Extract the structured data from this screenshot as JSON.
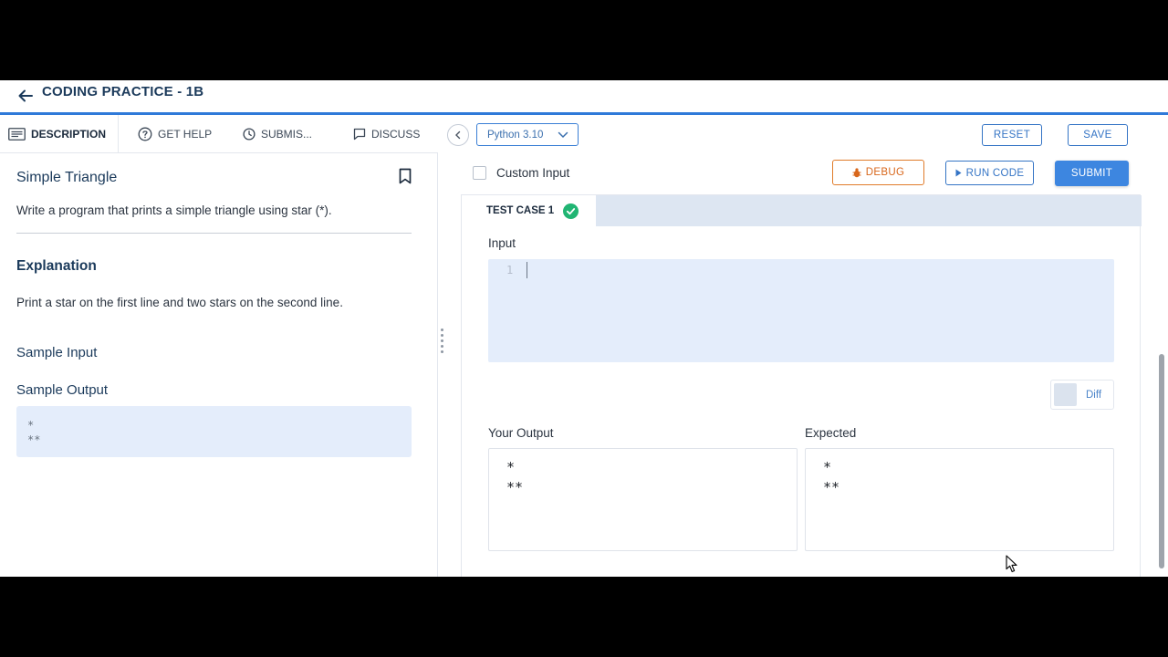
{
  "header": {
    "title": "CODING PRACTICE - 1B",
    "back_icon": "arrow-left-icon"
  },
  "left_tabs": [
    {
      "label": "DESCRIPTION",
      "icon": "description-icon",
      "active": true
    },
    {
      "label": "GET HELP",
      "icon": "help-circle-icon",
      "active": false
    },
    {
      "label": "SUBMIS...",
      "icon": "clock-icon",
      "active": false
    },
    {
      "label": "DISCUSS",
      "icon": "chat-icon",
      "active": false
    }
  ],
  "problem": {
    "title": "Simple Triangle",
    "statement": "Write a program that prints a simple triangle using star (*).",
    "explanation_title": "Explanation",
    "explanation": "Print a star on the first line and two stars on the second line.",
    "sample_input_label": "Sample Input",
    "sample_output_label": "Sample Output",
    "sample_output": "*\n**"
  },
  "editor_toolbar": {
    "language": "Python 3.10",
    "reset_label": "RESET",
    "save_label": "SAVE"
  },
  "run_bar": {
    "custom_input_label": "Custom Input",
    "custom_input_checked": false,
    "debug_label": "DEBUG",
    "run_label": "RUN CODE",
    "submit_label": "SUBMIT"
  },
  "test_case": {
    "tab_label": "TEST CASE 1",
    "passed": true,
    "input_label": "Input",
    "input_line_number": "1",
    "input_value": "",
    "diff_label": "Diff",
    "your_output_label": "Your Output",
    "your_output": "*\n**",
    "expected_label": "Expected",
    "expected_output": "*\n**"
  },
  "colors": {
    "accent": "#2f7ad9",
    "title": "#1b3a5b",
    "debug": "#e07b2a",
    "success": "#21b573",
    "submit": "#3d86e0"
  }
}
